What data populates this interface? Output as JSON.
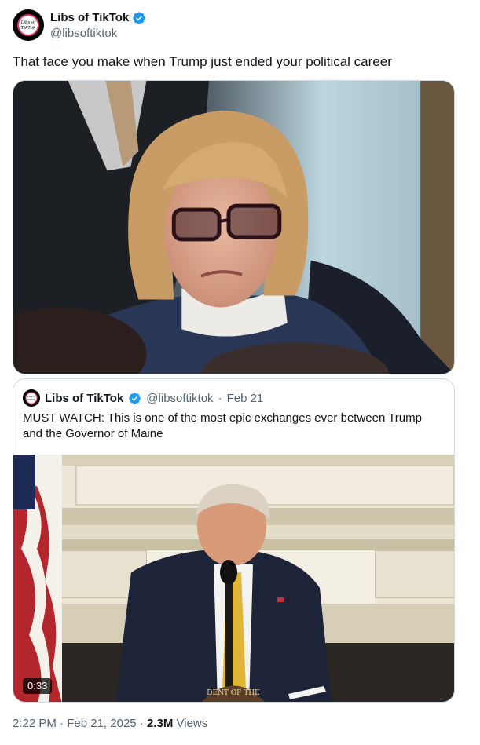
{
  "author": {
    "display_name": "Libs of TikTok",
    "handle": "@libsoftiktok",
    "avatar_text": "Libs of TikTok",
    "verified_icon": "verified-badge-icon"
  },
  "tweet": {
    "text": "That face you make when Trump just ended your political career"
  },
  "quote": {
    "display_name": "Libs of TikTok",
    "handle": "@libsoftiktok",
    "separator": "·",
    "date": "Feb 21",
    "text": "MUST WATCH: This is one of the most epic exchanges ever between Trump and the Governor of Maine",
    "video_duration": "0:33",
    "seal_text": "DENT OF THE"
  },
  "footer": {
    "time": "2:22 PM",
    "sep1": "·",
    "date": "Feb 21, 2025",
    "sep2": "·",
    "views_count": "2.3M",
    "views_label": "Views"
  },
  "colors": {
    "verified": "#1d9bf0",
    "text": "#0f1419",
    "secondary": "#536471",
    "border": "#cfd9de"
  }
}
